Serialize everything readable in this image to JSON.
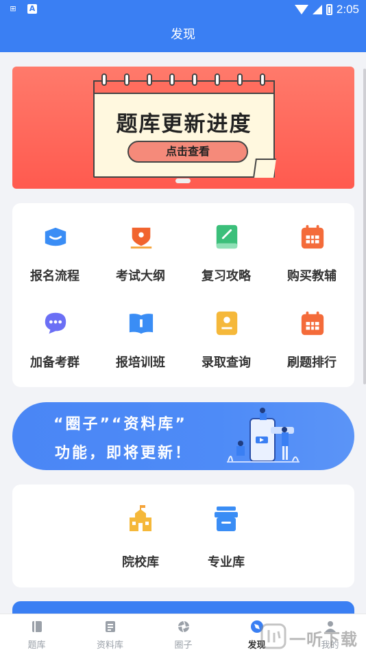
{
  "status_bar": {
    "time": "2:05",
    "notif_a": "A",
    "notif_grid": "⊞"
  },
  "title": "发现",
  "banner": {
    "title": "题库更新进度",
    "button": "点击查看"
  },
  "features": [
    {
      "label": "报名流程",
      "icon": "graduation-cap-icon",
      "color": "#3a8df5"
    },
    {
      "label": "考试大纲",
      "icon": "map-pin-icon",
      "color": "#f1642e"
    },
    {
      "label": "复习攻略",
      "icon": "notebook-icon",
      "color": "#3bbf7a"
    },
    {
      "label": "购买教辅",
      "icon": "calendar-icon",
      "color": "#f46b3a"
    },
    {
      "label": "加备考群",
      "icon": "chat-bubble-icon",
      "color": "#6b6ff5"
    },
    {
      "label": "报培训班",
      "icon": "open-book-icon",
      "color": "#3a8df5"
    },
    {
      "label": "录取查询",
      "icon": "certificate-icon",
      "color": "#f5b83a"
    },
    {
      "label": "刷题排行",
      "icon": "calendar-grid-icon",
      "color": "#f46b3a"
    }
  ],
  "announcement": {
    "line1": "“圈子”“资料库”",
    "line2": "功能，即将更新！"
  },
  "libraries": [
    {
      "label": "院校库",
      "icon": "school-building-icon",
      "color": "#f5b83a"
    },
    {
      "label": "专业库",
      "icon": "archive-box-icon",
      "color": "#3a8df5"
    }
  ],
  "tabs": [
    {
      "label": "题库",
      "icon": "book-icon"
    },
    {
      "label": "资料库",
      "icon": "document-icon"
    },
    {
      "label": "圈子",
      "icon": "aperture-icon"
    },
    {
      "label": "发现",
      "icon": "compass-icon",
      "active": true
    },
    {
      "label": "我的",
      "icon": "user-icon"
    }
  ],
  "watermark": {
    "text": "一听下载"
  }
}
